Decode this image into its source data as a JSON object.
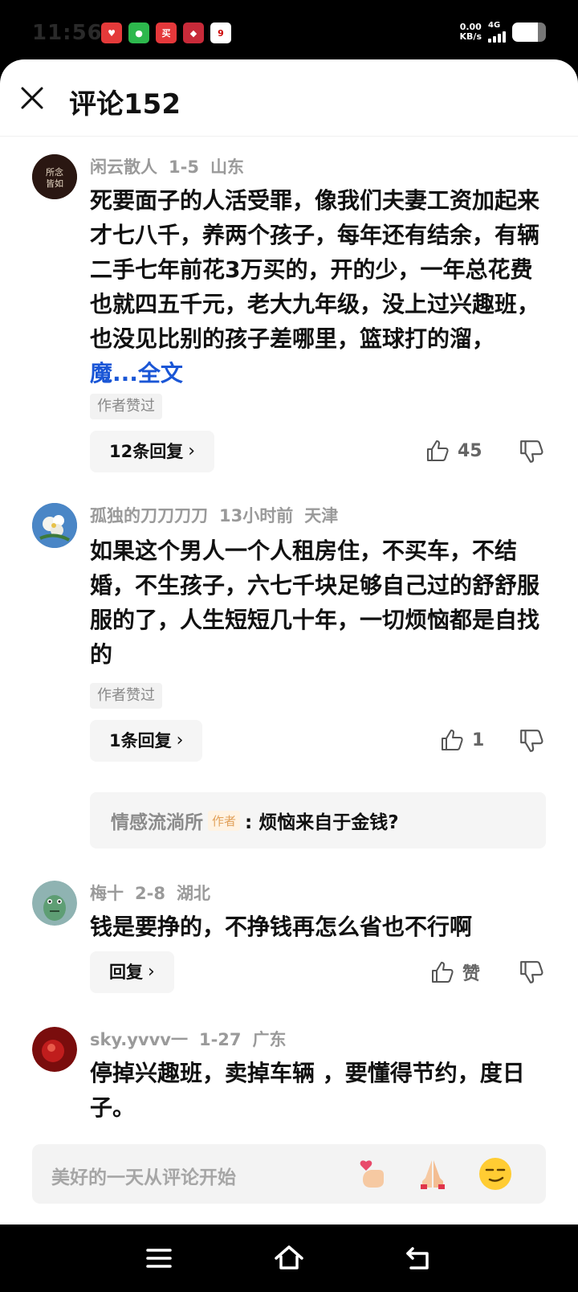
{
  "status_bar": {
    "time": "11:56",
    "apps": [
      {
        "name": "app-icon-1",
        "color": "#e43a3a",
        "glyph": "♥"
      },
      {
        "name": "wechat-icon",
        "color": "#2db84d",
        "glyph": "●"
      },
      {
        "name": "app-icon-3",
        "color": "#e5383b",
        "glyph": "买"
      },
      {
        "name": "app-icon-4",
        "color": "#c82a39",
        "glyph": "◆"
      },
      {
        "name": "calendar-icon",
        "color": "#ffffff",
        "glyph": "9"
      }
    ],
    "speed_value": "0.00",
    "speed_unit": "KB/s",
    "network": "4G",
    "battery_level": 0.75
  },
  "header": {
    "title": "评论152"
  },
  "comments": [
    {
      "user": "闲云散人",
      "time": "1-5",
      "location": "山东",
      "text": "死要面子的人活受罪，像我们夫妻工资加起来才七八千，养两个孩子，每年还有结余，有辆二手七年前花3万买的，开的少，一年总花费也就四五千元，老大九年级，没上过兴趣班，也没见比别的孩子差哪里，篮球打的溜，",
      "text_link": "魔...全文",
      "author_liked": "作者赞过",
      "reply_label": "12条回复",
      "likes": "45"
    },
    {
      "user": "孤独的刀刀刀刀",
      "time": "13小时前",
      "location": "天津",
      "text": "如果这个男人一个人租房住，不买车，不结婚，不生孩子，六七千块足够自己过的舒舒服服的了，人生短短几十年，一切烦恼都是自找的",
      "author_liked": "作者赞过",
      "reply_label": "1条回复",
      "likes": "1",
      "quoted": {
        "name": "情感流淌所",
        "tag": "作者",
        "text": ": 烦恼来自于金钱?"
      }
    },
    {
      "user": "梅十",
      "time": "2-8",
      "location": "湖北",
      "text": "钱是要挣的，不挣钱再怎么省也不行啊",
      "reply_label": "回复",
      "likes": "赞"
    },
    {
      "user": "sky.yvvv一",
      "time": "1-27",
      "location": "广东",
      "text": "停掉兴趣班，卖掉车辆 ，要懂得节约，度日子。"
    }
  ],
  "input": {
    "placeholder": "美好的一天从评论开始",
    "emojis": [
      "finger-heart-emoji",
      "praying-hands-emoji",
      "smirk-face-emoji"
    ]
  },
  "nav": [
    "menu-icon",
    "home-icon",
    "back-icon"
  ]
}
